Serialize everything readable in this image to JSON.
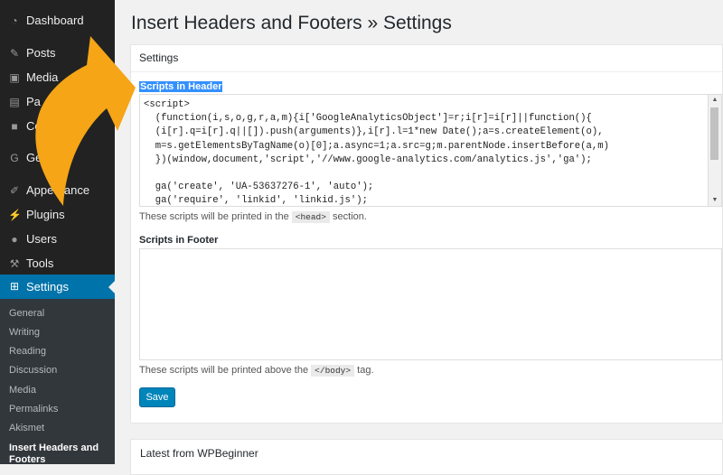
{
  "sidebar": {
    "items": [
      {
        "label": "Dashboard",
        "icon": "dashboard-icon"
      },
      {
        "label": "Posts",
        "icon": "pin-icon"
      },
      {
        "label": "Media",
        "icon": "media-icon"
      },
      {
        "label": "Pa",
        "icon": "page-icon"
      },
      {
        "label": "Co",
        "icon": "comment-icon"
      },
      {
        "label": "Gen",
        "icon": "g-icon"
      },
      {
        "label": "Appearance",
        "icon": "brush-icon"
      },
      {
        "label": "Plugins",
        "icon": "plug-icon"
      },
      {
        "label": "Users",
        "icon": "user-icon"
      },
      {
        "label": "Tools",
        "icon": "wrench-icon"
      },
      {
        "label": "Settings",
        "icon": "settings-icon"
      }
    ],
    "submenu": [
      "General",
      "Writing",
      "Reading",
      "Discussion",
      "Media",
      "Permalinks",
      "Akismet",
      "Insert Headers and",
      "Footers"
    ]
  },
  "page": {
    "title": "Insert Headers and Footers » Settings",
    "panel_title": "Settings",
    "header_label": "Scripts in Header",
    "header_code": [
      "<script>",
      "  (function(i,s,o,g,r,a,m){i['GoogleAnalyticsObject']=r;i[r]=i[r]||function(){",
      "  (i[r].q=i[r].q||[]).push(arguments)},i[r].l=1*new Date();a=s.createElement(o),",
      "  m=s.getElementsByTagName(o)[0];a.async=1;a.src=g;m.parentNode.insertBefore(a,m)",
      "  })(window,document,'script','//www.google-analytics.com/analytics.js','ga');",
      "",
      "  ga('create', 'UA-53637276-1', 'auto');",
      "  ga('require', 'linkid', 'linkid.js');"
    ],
    "header_desc_before": "These scripts will be printed in the",
    "header_desc_code": "<head>",
    "header_desc_after": "section.",
    "footer_label": "Scripts in Footer",
    "footer_value": "",
    "footer_desc_before": "These scripts will be printed above the",
    "footer_desc_code": "</body>",
    "footer_desc_after": "tag.",
    "save_label": "Save",
    "news_title": "Latest from WPBeginner"
  },
  "colors": {
    "sidebar_bg": "#222222",
    "submenu_bg": "#32373c",
    "active_bg": "#0073aa",
    "button_bg": "#0085ba",
    "highlight": "#3390ff",
    "arrow": "#f5a516"
  }
}
